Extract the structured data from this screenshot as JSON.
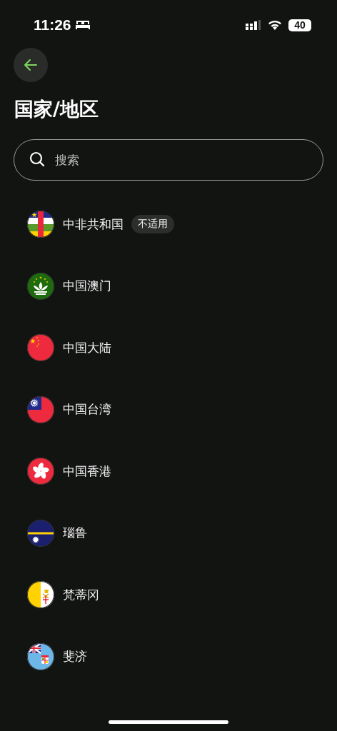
{
  "status_bar": {
    "time": "11:26",
    "battery": "40"
  },
  "header": {
    "title": "国家/地区"
  },
  "search": {
    "placeholder": "搜索"
  },
  "countries": [
    {
      "name": "中非共和国",
      "badge": "不适用"
    },
    {
      "name": "中国澳门"
    },
    {
      "name": "中国大陆"
    },
    {
      "name": "中国台湾"
    },
    {
      "name": "中国香港"
    },
    {
      "name": "瑙鲁"
    },
    {
      "name": "梵蒂冈"
    },
    {
      "name": "斐济"
    }
  ]
}
